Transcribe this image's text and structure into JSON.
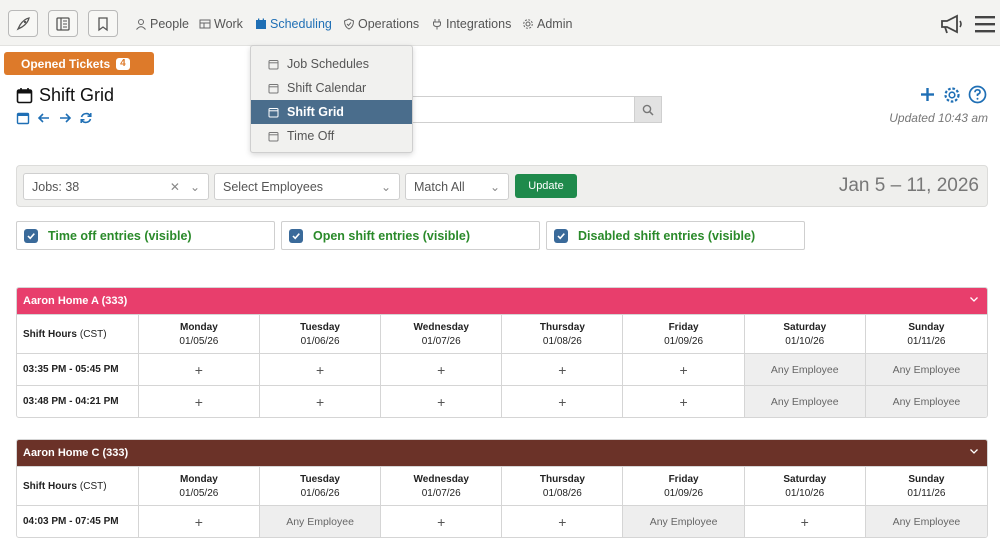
{
  "nav": {
    "items": [
      {
        "label": "People",
        "icon": "person-icon"
      },
      {
        "label": "Work",
        "icon": "work-icon"
      },
      {
        "label": "Scheduling",
        "icon": "calendar-icon"
      },
      {
        "label": "Operations",
        "icon": "shield-icon"
      },
      {
        "label": "Integrations",
        "icon": "plug-icon"
      },
      {
        "label": "Admin",
        "icon": "gear-icon"
      }
    ],
    "active": "Scheduling"
  },
  "opened_tickets": {
    "label": "Opened Tickets",
    "count": "4"
  },
  "page": {
    "title": "Shift Grid",
    "updated": "Updated 10:43 am"
  },
  "dropdown": {
    "items": [
      "Job Schedules",
      "Shift Calendar",
      "Shift Grid",
      "Time Off"
    ],
    "selected": "Shift Grid"
  },
  "filters": {
    "jobs": "Jobs: 38",
    "employees_placeholder": "Select Employees",
    "match": "Match All",
    "update_label": "Update",
    "date_range": "Jan 5 – 11, 2026"
  },
  "toggles": [
    {
      "label": "Time off entries (visible)",
      "checked": true
    },
    {
      "label": "Open shift entries (visible)",
      "checked": true
    },
    {
      "label": "Disabled shift entries (visible)",
      "checked": true
    }
  ],
  "days": [
    {
      "name": "Monday",
      "date": "01/05/26"
    },
    {
      "name": "Tuesday",
      "date": "01/06/26"
    },
    {
      "name": "Wednesday",
      "date": "01/07/26"
    },
    {
      "name": "Thursday",
      "date": "01/08/26"
    },
    {
      "name": "Friday",
      "date": "01/09/26"
    },
    {
      "name": "Saturday",
      "date": "01/10/26"
    },
    {
      "name": "Sunday",
      "date": "01/11/26"
    }
  ],
  "shift_hours_label": "Shift Hours",
  "tz": "(CST)",
  "grids": [
    {
      "title": "Aaron Home A  (333)",
      "color": "#e83e6c",
      "rows": [
        {
          "time": "03:35 PM - 05:45 PM",
          "cells": [
            "+",
            "+",
            "+",
            "+",
            "+",
            "Any Employee",
            "Any Employee"
          ]
        },
        {
          "time": "03:48 PM - 04:21 PM",
          "cells": [
            "+",
            "+",
            "+",
            "+",
            "+",
            "Any Employee",
            "Any Employee"
          ]
        }
      ]
    },
    {
      "title": "Aaron Home C  (333)",
      "color": "#6b3228",
      "rows": [
        {
          "time": "04:03 PM - 07:45 PM",
          "cells": [
            "+",
            "Any Employee",
            "+",
            "+",
            "Any Employee",
            "+",
            "Any Employee"
          ]
        }
      ]
    }
  ]
}
